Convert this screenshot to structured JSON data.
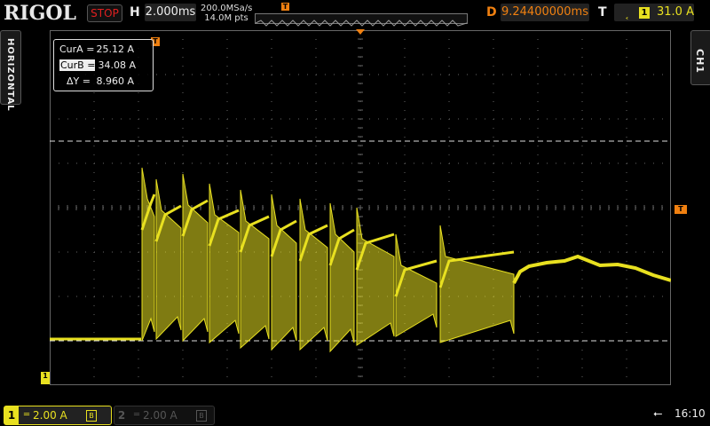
{
  "header": {
    "brand": "RIGOL",
    "run_state": "STOP",
    "h_label": "H",
    "timebase": "2.000ms",
    "sample_rate": "200.0MSa/s",
    "memory_depth": "14.0M pts",
    "trigger_marker": "T",
    "d_label": "D",
    "delay": "9.24400000ms",
    "t_label": "T",
    "trigger_edge_icon": "rising-edge-icon",
    "trigger_channel": "1",
    "trigger_level": "31.0 A"
  },
  "side_tabs": {
    "left": "HORIZONTAL",
    "right": "CH1"
  },
  "cursor_readout": {
    "cur_a_label": "CurA =",
    "cur_a_value": "25.12 A",
    "cur_b_label": "CurB =",
    "cur_b_value": "34.08 A",
    "delta_label": "ΔY =",
    "delta_value": "8.960 A"
  },
  "markers": {
    "trigger_pos": "T",
    "trigger_level": "T",
    "ch1_ground": "1"
  },
  "footer": {
    "ch1": {
      "number": "1",
      "coupling": "═",
      "scale": "2.00 A",
      "bw": "B"
    },
    "ch2": {
      "number": "2",
      "coupling": "═",
      "scale": "2.00 A",
      "bw": "B"
    },
    "usb_icon": "usb-icon",
    "time": "16:10"
  },
  "colors": {
    "ch1": "#e8e020",
    "accent": "#f08010",
    "stop": "#e02020"
  }
}
